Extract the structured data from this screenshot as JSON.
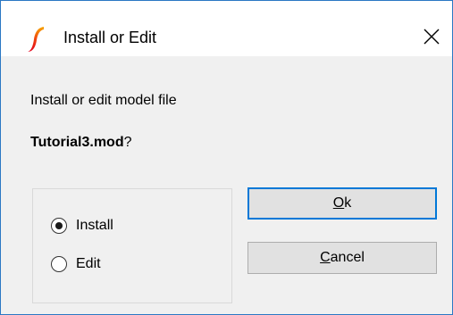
{
  "window": {
    "title": "Install or Edit",
    "app_icon": "simetrix-logo-icon",
    "close_icon": "close-icon"
  },
  "dialog": {
    "message": "Install or edit model file",
    "filename": "Tutorial3.mod",
    "filename_suffix": "?"
  },
  "options": {
    "items": [
      {
        "label": "Install",
        "selected": true
      },
      {
        "label": "Edit",
        "selected": false
      }
    ]
  },
  "buttons": {
    "ok": {
      "mnemonic": "O",
      "rest": "k"
    },
    "cancel": {
      "mnemonic": "C",
      "rest": "ancel"
    }
  },
  "colors": {
    "accent": "#0078d7",
    "window_border": "#2b78c4",
    "dialog_bg": "#f0f0f0",
    "button_bg": "#e1e1e1",
    "icon_red": "#e3001b",
    "icon_orange": "#f7a600"
  }
}
